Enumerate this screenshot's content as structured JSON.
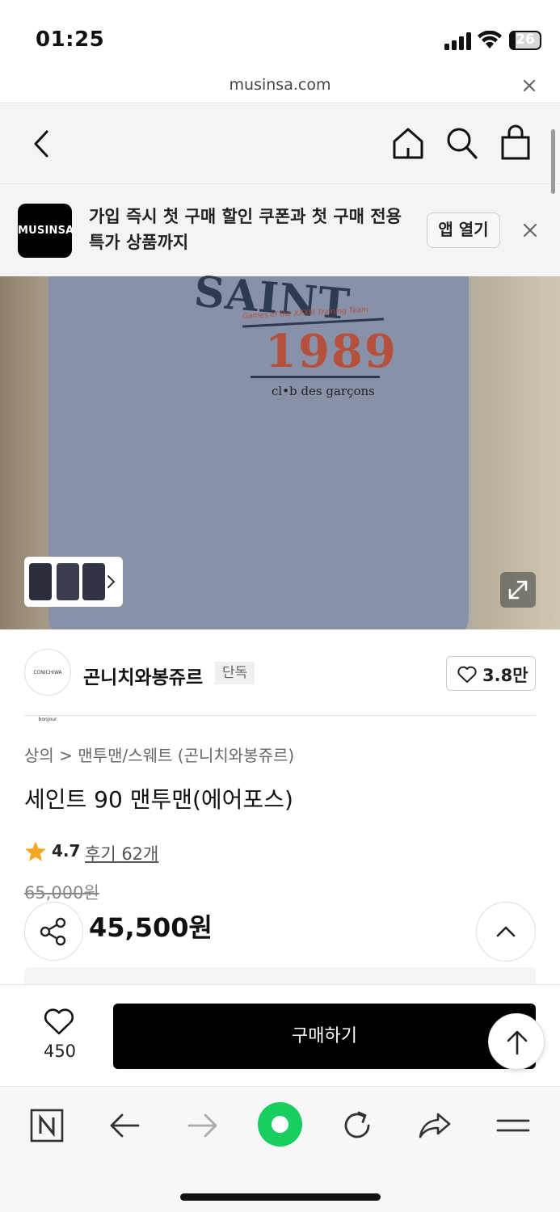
{
  "status_bar": {
    "time": "01:25",
    "battery": "26"
  },
  "browser": {
    "url": "musinsa.com"
  },
  "app_banner": {
    "logo_text": "MUSINSA",
    "message": "가입 즉시 첫 구매 할인 쿠폰과 첫 구매 전용 특가 상품까지",
    "open_app_label": "앱 열기"
  },
  "product_image": {
    "print_top": "SAINT LOUIS",
    "print_sub": "Games of the XXXIII Training Team",
    "print_year": "1989",
    "print_brand": "cl•b des garçons"
  },
  "brand": {
    "logo_text": "CONICHIWA bonjour",
    "name": "곤니치와봉쥬르",
    "badge": "단독",
    "like_count": "3.8만"
  },
  "product": {
    "breadcrumb": "상의 > 맨투맨/스웨트 (곤니치와봉쥬르)",
    "title": "세인트 90 맨투맨(에어포스)",
    "rating": "4.7",
    "review_link": "후기 62개",
    "original_price": "65,000원",
    "sale_price": "45,500원"
  },
  "buy_bar": {
    "wish_count": "450",
    "buy_label": "구매하기"
  },
  "colors": {
    "accent_green": "#19ce60",
    "star": "#f5a623",
    "buy_button": "#000000"
  }
}
